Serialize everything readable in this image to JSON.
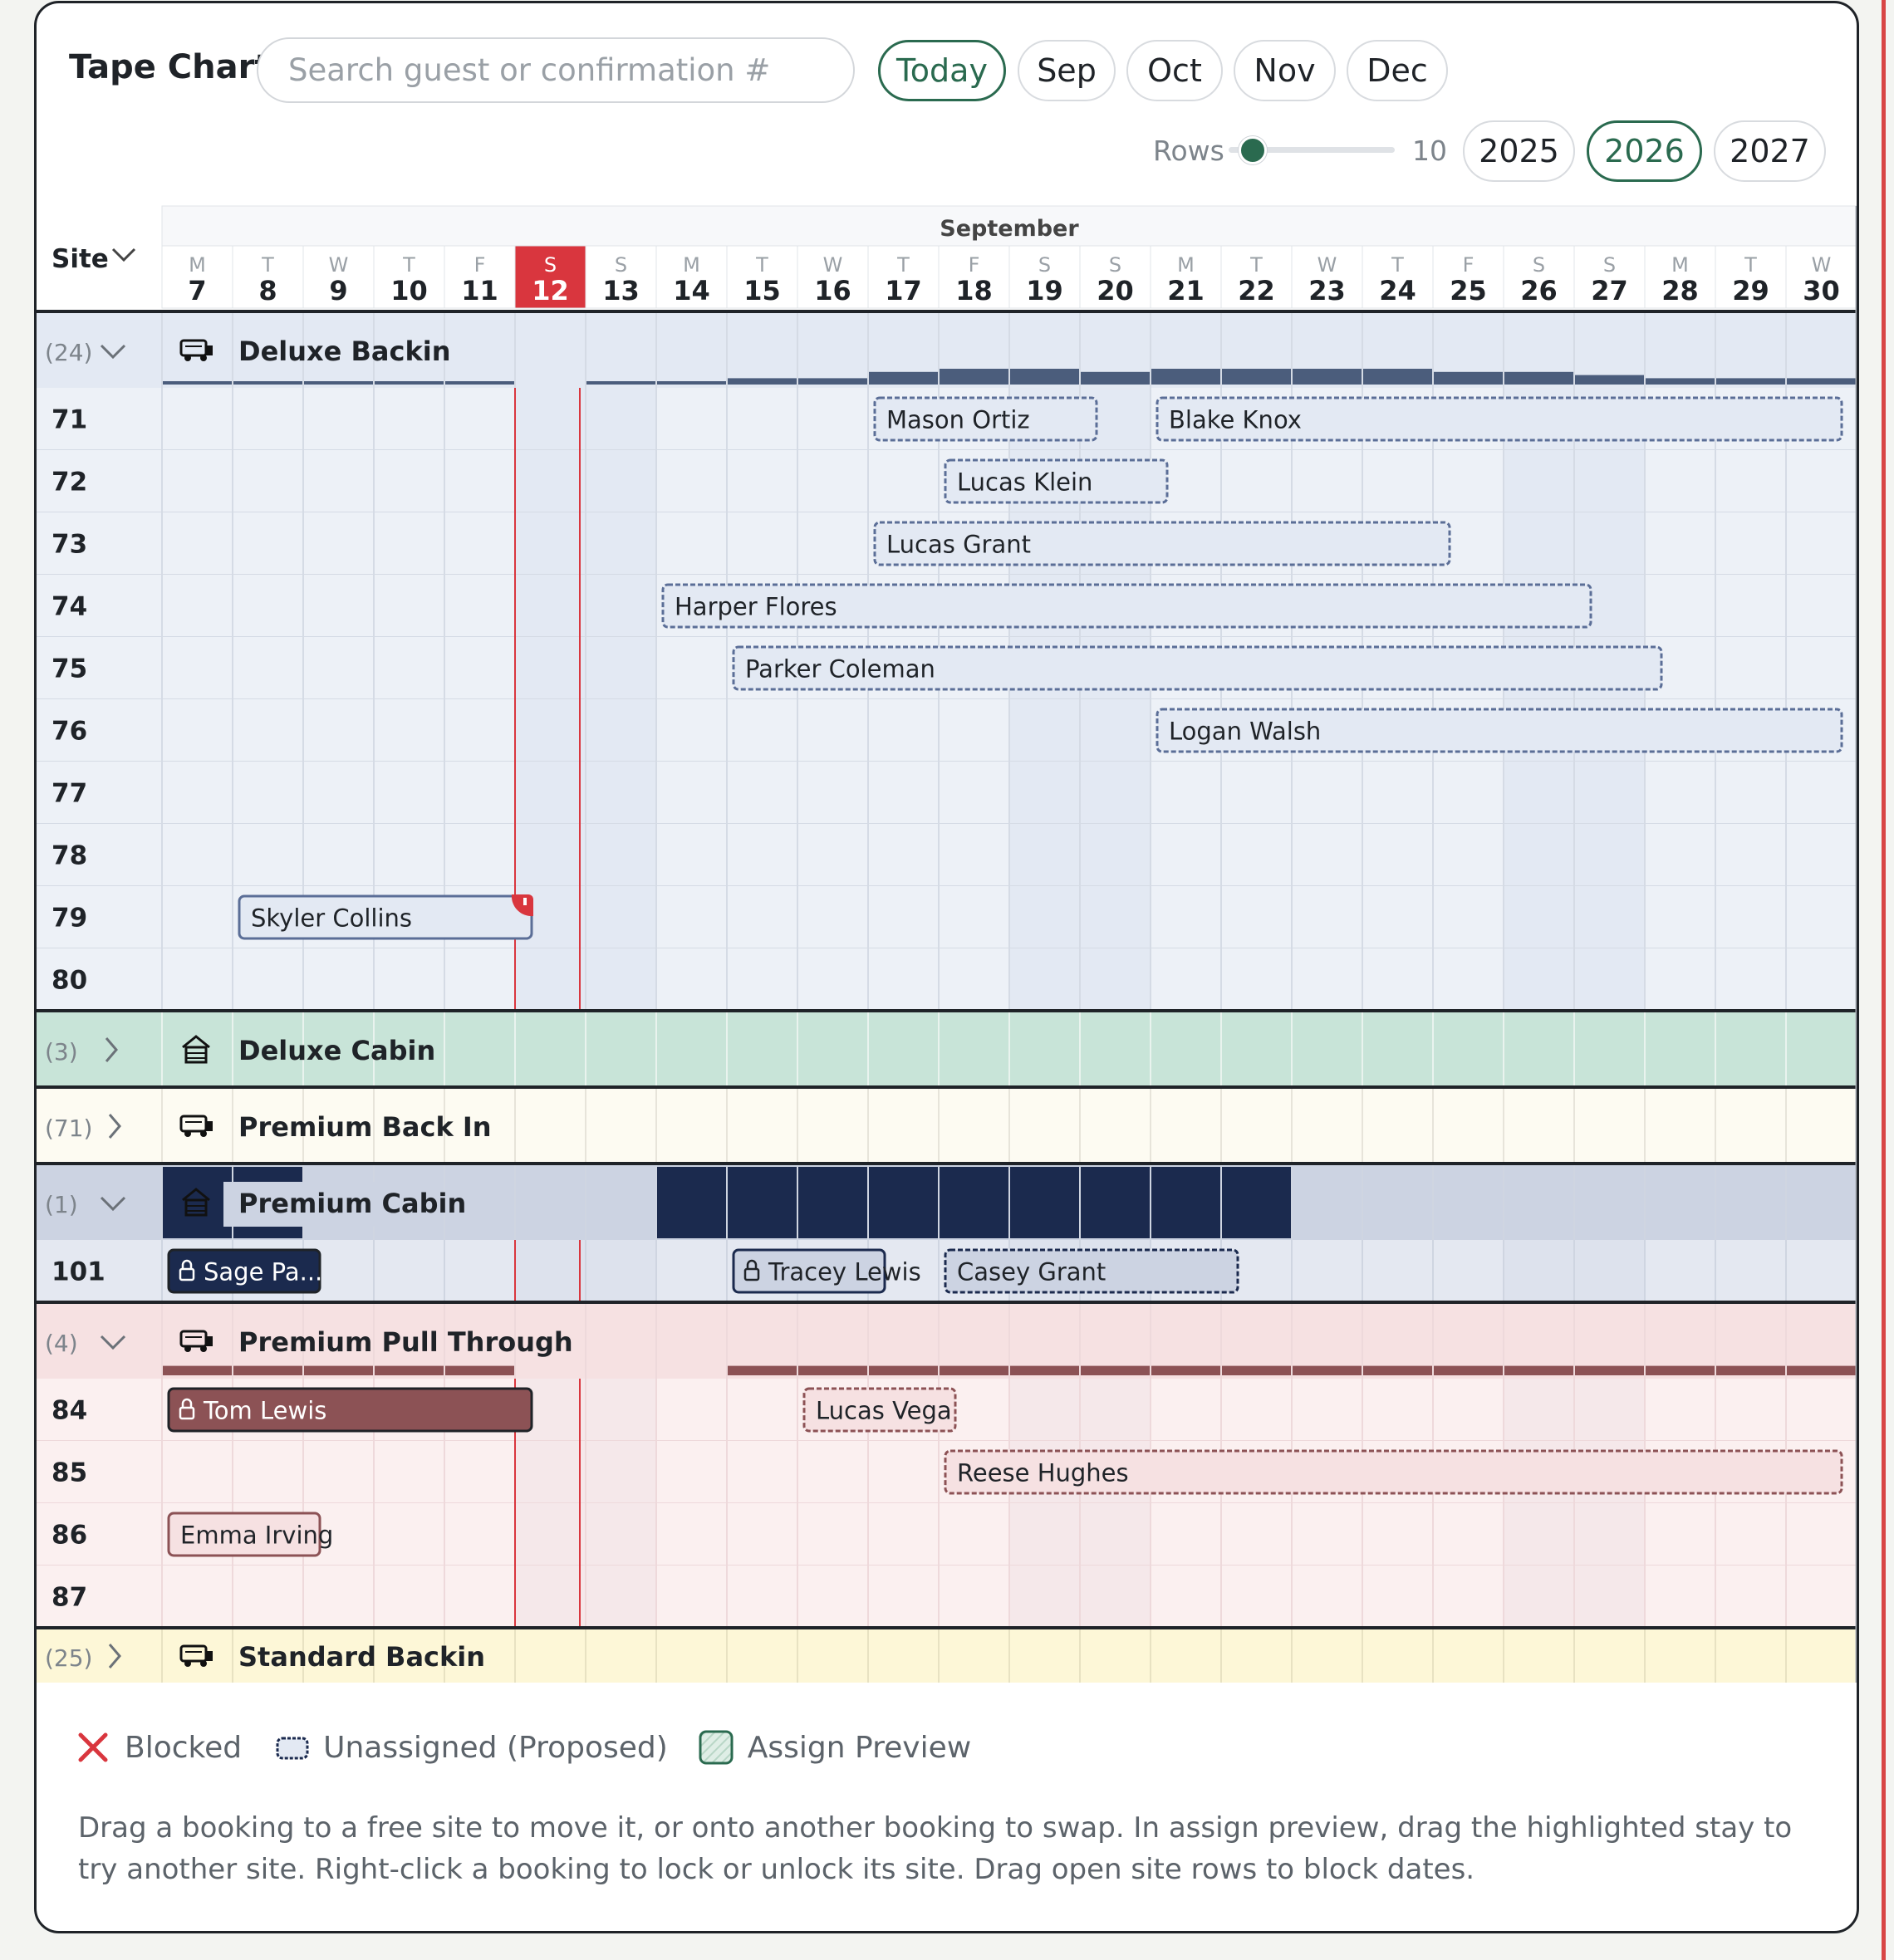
{
  "header": {
    "title": "Tape Chart",
    "search_placeholder": "Search guest or confirmation #",
    "nav_buttons": [
      {
        "label": "Today",
        "active": true
      },
      {
        "label": "Sep",
        "active": false
      },
      {
        "label": "Oct",
        "active": false
      },
      {
        "label": "Nov",
        "active": false
      },
      {
        "label": "Dec",
        "active": false
      }
    ],
    "rows_label": "Rows",
    "rows_value": "10",
    "rows_slider_fraction": 0.1,
    "years": [
      {
        "label": "2025",
        "active": false
      },
      {
        "label": "2026",
        "active": true
      },
      {
        "label": "2027",
        "active": false
      }
    ]
  },
  "calendar": {
    "month": "September",
    "site_header": "Site",
    "today": 12,
    "days": [
      {
        "dow": "M",
        "day": 7
      },
      {
        "dow": "T",
        "day": 8
      },
      {
        "dow": "W",
        "day": 9
      },
      {
        "dow": "T",
        "day": 10
      },
      {
        "dow": "F",
        "day": 11
      },
      {
        "dow": "S",
        "day": 12
      },
      {
        "dow": "S",
        "day": 13
      },
      {
        "dow": "M",
        "day": 14
      },
      {
        "dow": "T",
        "day": 15
      },
      {
        "dow": "W",
        "day": 16
      },
      {
        "dow": "T",
        "day": 17
      },
      {
        "dow": "F",
        "day": 18
      },
      {
        "dow": "S",
        "day": 19
      },
      {
        "dow": "S",
        "day": 20
      },
      {
        "dow": "M",
        "day": 21
      },
      {
        "dow": "T",
        "day": 22
      },
      {
        "dow": "W",
        "day": 23
      },
      {
        "dow": "T",
        "day": 24
      },
      {
        "dow": "F",
        "day": 25
      },
      {
        "dow": "S",
        "day": 26
      },
      {
        "dow": "S",
        "day": 27
      },
      {
        "dow": "M",
        "day": 28
      },
      {
        "dow": "T",
        "day": 29
      },
      {
        "dow": "W",
        "day": 30
      }
    ]
  },
  "groups": [
    {
      "name": "Deluxe Backin",
      "count": "(24)",
      "expanded": true,
      "icon": "rv-icon",
      "theme": "blue",
      "sites": [
        "71",
        "72",
        "73",
        "74",
        "75",
        "76",
        "77",
        "78",
        "79",
        "80"
      ],
      "occupancy": [
        0.1,
        0.1,
        0.1,
        0.1,
        0.1,
        0.0,
        0.1,
        0.1,
        0.2,
        0.2,
        0.4,
        0.5,
        0.5,
        0.4,
        0.5,
        0.5,
        0.5,
        0.5,
        0.4,
        0.4,
        0.3,
        0.2,
        0.2,
        0.2
      ],
      "bookings": [
        {
          "site": "71",
          "guest": "Mason Ortiz",
          "start": 17,
          "end": 20,
          "proposed": true,
          "locked": false
        },
        {
          "site": "71",
          "guest": "Blake Knox",
          "start": 21,
          "end": 30,
          "proposed": true,
          "locked": false
        },
        {
          "site": "72",
          "guest": "Lucas Klein",
          "start": 18,
          "end": 21,
          "proposed": true,
          "locked": false
        },
        {
          "site": "73",
          "guest": "Lucas Grant",
          "start": 17,
          "end": 25,
          "proposed": true,
          "locked": false
        },
        {
          "site": "74",
          "guest": "Harper Flores",
          "start": 14,
          "end": 27,
          "proposed": true,
          "locked": false
        },
        {
          "site": "75",
          "guest": "Parker Coleman",
          "start": 15,
          "end": 28,
          "proposed": true,
          "locked": false
        },
        {
          "site": "76",
          "guest": "Logan Walsh",
          "start": 21,
          "end": 30,
          "proposed": true,
          "locked": false
        },
        {
          "site": "79",
          "guest": "Skyler Collins",
          "start": 8,
          "end": 12,
          "proposed": false,
          "locked": false,
          "flag": true
        }
      ]
    },
    {
      "name": "Deluxe Cabin",
      "count": "(3)",
      "expanded": false,
      "icon": "cabin-icon",
      "theme": "green",
      "sites": [],
      "occupancy": [],
      "bookings": []
    },
    {
      "name": "Premium Back In",
      "count": "(71)",
      "expanded": false,
      "icon": "rv-icon",
      "theme": "cream",
      "sites": [],
      "occupancy": [],
      "bookings": []
    },
    {
      "name": "Premium Cabin",
      "count": "(1)",
      "expanded": true,
      "icon": "cabin-icon",
      "theme": "navy",
      "sites": [
        "101"
      ],
      "occupancy": [
        1,
        1,
        0,
        0,
        0,
        0,
        0,
        1,
        1,
        1,
        1,
        1,
        1,
        1,
        1,
        1,
        0,
        0,
        0,
        0,
        0,
        0,
        0,
        0
      ],
      "bookings": [
        {
          "site": "101",
          "guest": "Sage Pa...",
          "start": 7,
          "end": 9,
          "proposed": false,
          "locked": true,
          "solid": true
        },
        {
          "site": "101",
          "guest": "Tracey Lewis",
          "start": 15,
          "end": 17,
          "proposed": false,
          "locked": true
        },
        {
          "site": "101",
          "guest": "Casey Grant",
          "start": 18,
          "end": 22,
          "proposed": true,
          "locked": false
        }
      ]
    },
    {
      "name": "Premium Pull Through",
      "count": "(4)",
      "expanded": true,
      "icon": "rv-icon",
      "theme": "red",
      "sites": [
        "84",
        "85",
        "86",
        "87"
      ],
      "occupancy": [
        0.3,
        0.3,
        0.3,
        0.3,
        0.3,
        0.0,
        0.0,
        0.0,
        0.3,
        0.3,
        0.3,
        0.3,
        0.3,
        0.3,
        0.3,
        0.3,
        0.3,
        0.3,
        0.3,
        0.3,
        0.3,
        0.3,
        0.3,
        0.3
      ],
      "bookings": [
        {
          "site": "84",
          "guest": "Tom Lewis",
          "start": 7,
          "end": 12,
          "proposed": false,
          "locked": true,
          "solid": true
        },
        {
          "site": "84",
          "guest": "Lucas Vega",
          "start": 16,
          "end": 18,
          "proposed": true,
          "locked": false
        },
        {
          "site": "85",
          "guest": "Reese Hughes",
          "start": 18,
          "end": 30,
          "proposed": true,
          "locked": false
        },
        {
          "site": "86",
          "guest": "Emma Irving",
          "start": 7,
          "end": 9,
          "proposed": false,
          "locked": false
        }
      ]
    },
    {
      "name": "Standard Backin",
      "count": "(25)",
      "expanded": false,
      "icon": "rv-icon",
      "theme": "yellow",
      "partial": true,
      "sites": [],
      "occupancy": [],
      "bookings": []
    }
  ],
  "legend": {
    "blocked": "Blocked",
    "unassigned": "Unassigned (Proposed)",
    "preview": "Assign Preview"
  },
  "help_text": "Drag a booking to a free site to move it, or onto another booking to swap. In assign preview, drag the highlighted stay to try another site. Right-click a booking to lock or unlock its site. Drag open site rows to block dates.",
  "colors": {
    "accent": "#2a6a4f",
    "today": "#d9363e",
    "blue_group": "#e3e9f3",
    "navy": "#1b2a4e",
    "green_group": "#c8e4d8",
    "red_group": "#f6e1e2",
    "red_solid": "#8c5255"
  }
}
